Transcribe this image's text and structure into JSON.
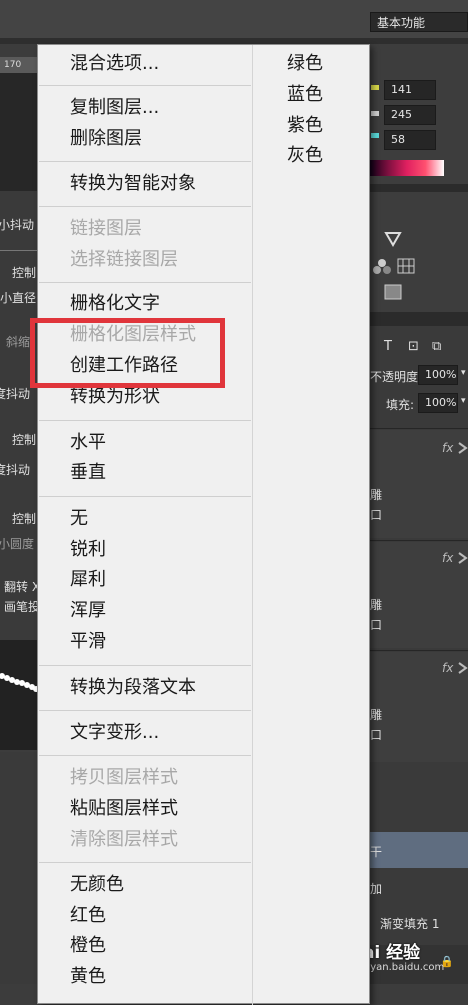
{
  "workspace": {
    "label": "基本功能"
  },
  "ruler": {
    "mark": "170"
  },
  "color_panel": {
    "r": "141",
    "g": "245",
    "b": "58"
  },
  "brush_panel": {
    "labels": [
      "小抖动",
      "控制",
      "小直径",
      "斜缩",
      "度抖动",
      "控制",
      "度抖动",
      "控制",
      "小圆度",
      "翻转 X",
      "画笔投"
    ]
  },
  "layers_panel": {
    "opacity_label": "不透明度:",
    "opacity_value": "100%",
    "fill_label": "填充:",
    "fill_value": "100%",
    "fx": "fx",
    "layer_fragment": "雕",
    "gradient_fill_label": "渐变填充 1",
    "plus_fragment": "加",
    "selected_fragment": "干"
  },
  "watermark": {
    "brand": "Bai 经验",
    "url": "jingyan.baidu.com"
  },
  "context_menu": {
    "items": [
      {
        "label": "混合选项...",
        "enabled": true
      },
      {
        "label": "复制图层...",
        "enabled": true
      },
      {
        "label": "删除图层",
        "enabled": true
      },
      {
        "label": "转换为智能对象",
        "enabled": true
      },
      {
        "label": "链接图层",
        "enabled": false
      },
      {
        "label": "选择链接图层",
        "enabled": false
      },
      {
        "label": "栅格化文字",
        "enabled": true
      },
      {
        "label": "栅格化图层样式",
        "enabled": false
      },
      {
        "label": "创建工作路径",
        "enabled": true
      },
      {
        "label": "转换为形状",
        "enabled": true
      },
      {
        "label": "水平",
        "enabled": true
      },
      {
        "label": "垂直",
        "enabled": true
      },
      {
        "label": "无",
        "enabled": true
      },
      {
        "label": "锐利",
        "enabled": true
      },
      {
        "label": "犀利",
        "enabled": true
      },
      {
        "label": "浑厚",
        "enabled": true
      },
      {
        "label": "平滑",
        "enabled": true
      },
      {
        "label": "转换为段落文本",
        "enabled": true
      },
      {
        "label": "文字变形...",
        "enabled": true
      },
      {
        "label": "拷贝图层样式",
        "enabled": false
      },
      {
        "label": "粘贴图层样式",
        "enabled": true
      },
      {
        "label": "清除图层样式",
        "enabled": false
      },
      {
        "label": "无颜色",
        "enabled": true
      },
      {
        "label": "红色",
        "enabled": true
      },
      {
        "label": "橙色",
        "enabled": true
      },
      {
        "label": "黄色",
        "enabled": true
      }
    ],
    "color_items": [
      "绿色",
      "蓝色",
      "紫色",
      "灰色"
    ],
    "highlighted_item": "创建工作路径"
  }
}
